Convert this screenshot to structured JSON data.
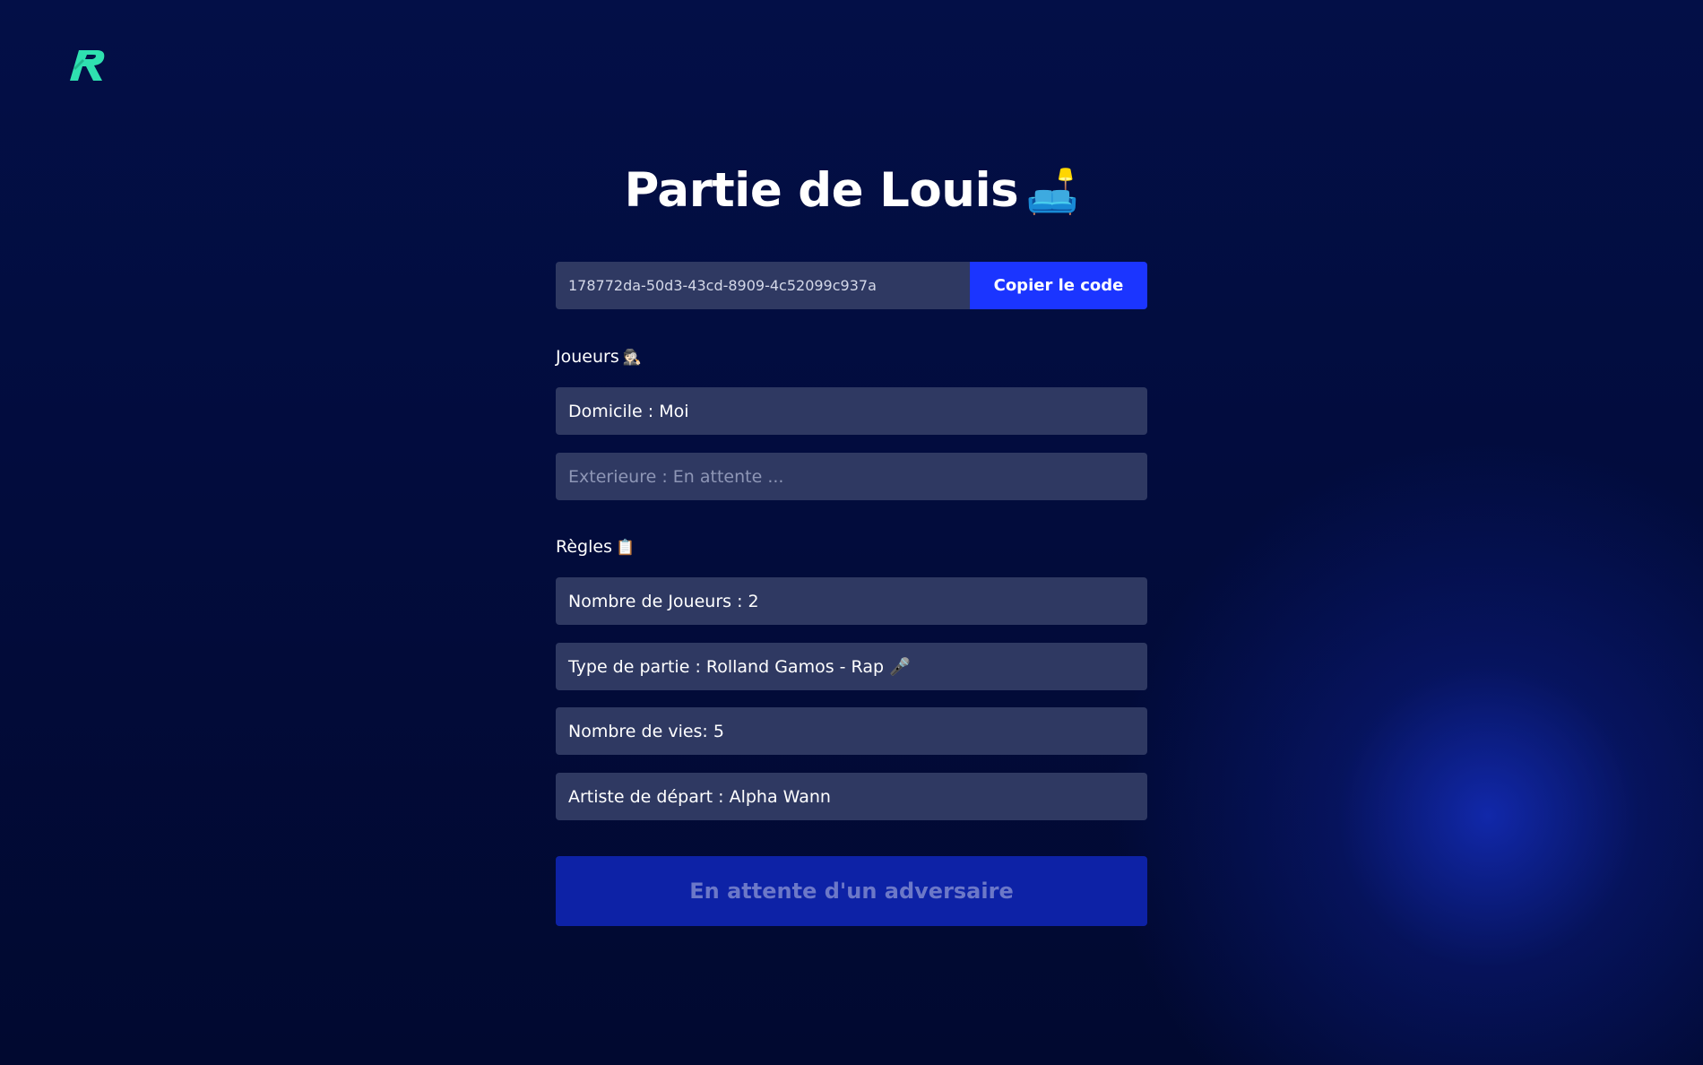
{
  "brand": {
    "logo_icon": "rolland-gamos-r-logo",
    "accent_color": "#2fe0b0"
  },
  "page": {
    "title": "Partie de Louis",
    "title_emoji": "🛋️"
  },
  "game_code": {
    "value": "178772da-50d3-43cd-8909-4c52099c937a",
    "copy_label": "Copier le code"
  },
  "players": {
    "label": "Joueurs",
    "emoji": "🕵🏻",
    "home_value": "Domicile : Moi",
    "away_placeholder": "Exterieure : En attente ..."
  },
  "rules": {
    "label": "Règles",
    "emoji": "📋",
    "items": [
      {
        "text": "Nombre de Joueurs : 2"
      },
      {
        "text": "Type de partie : Rolland Gamos - Rap 🎤"
      },
      {
        "text": "Nombre de vies: 5"
      },
      {
        "text": "Artiste de départ : Alpha Wann"
      }
    ]
  },
  "action": {
    "label": "En attente d'un adversaire"
  },
  "colors": {
    "background_top": "#030f47",
    "field_bg": "#2f3962",
    "primary_button": "#1b35ff",
    "disabled_button": "#0d22a6"
  }
}
